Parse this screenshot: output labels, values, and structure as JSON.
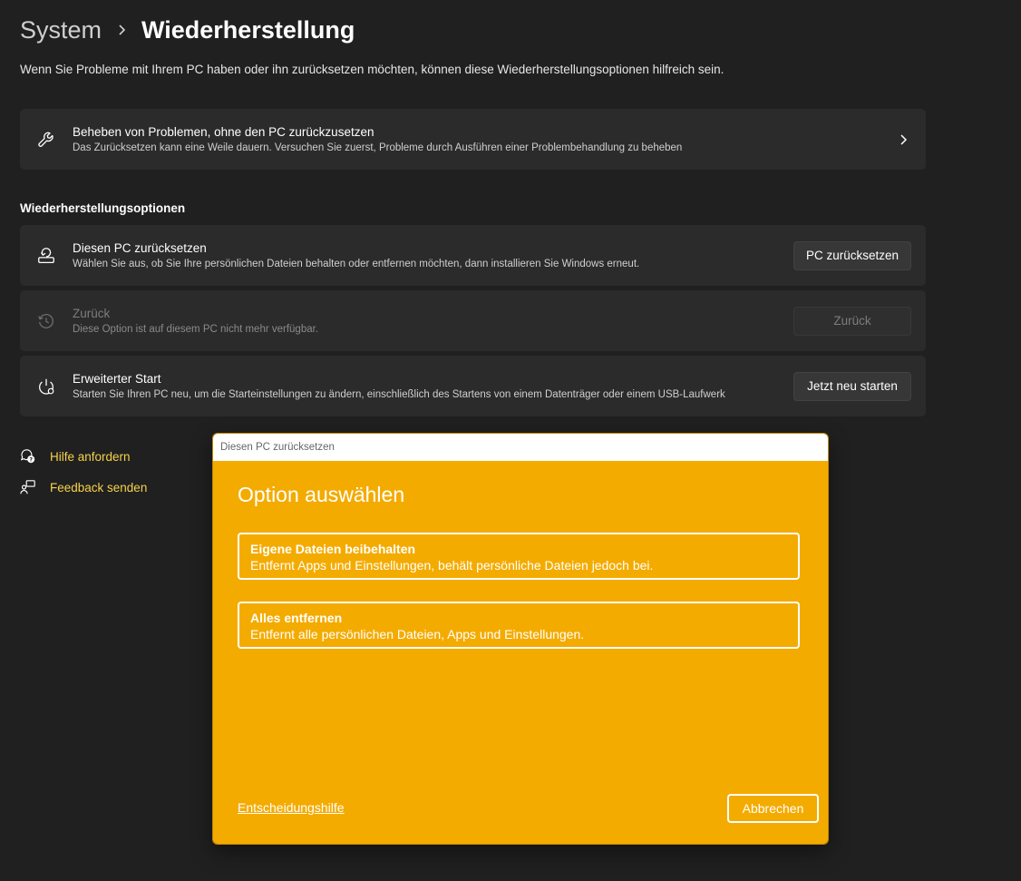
{
  "breadcrumb": {
    "parent": "System",
    "current": "Wiederherstellung"
  },
  "intro": "Wenn Sie Probleme mit Ihrem PC haben oder ihn zurücksetzen möchten, können diese Wiederherstellungsoptionen hilfreich sein.",
  "troubleshoot": {
    "title": "Beheben von Problemen, ohne den PC zurückzusetzen",
    "desc": "Das Zurücksetzen kann eine Weile dauern. Versuchen Sie zuerst, Probleme durch Ausführen einer Problembehandlung zu beheben",
    "icon": "wrench-icon"
  },
  "section_title": "Wiederherstellungsoptionen",
  "options": [
    {
      "title": "Diesen PC zurücksetzen",
      "desc": "Wählen Sie aus, ob Sie Ihre persönlichen Dateien behalten oder entfernen möchten, dann installieren Sie Windows erneut.",
      "button": "PC zurücksetzen",
      "icon": "reset-pc-icon"
    },
    {
      "title": "Zurück",
      "desc": "Diese Option ist auf diesem PC nicht mehr verfügbar.",
      "button": "Zurück",
      "icon": "history-icon"
    },
    {
      "title": "Erweiterter Start",
      "desc": "Starten Sie Ihren PC neu, um die Starteinstellungen zu ändern, einschließlich des Startens von einem Datenträger oder einem USB-Laufwerk",
      "button": "Jetzt neu starten",
      "icon": "advanced-startup-icon"
    }
  ],
  "links": {
    "help": "Hilfe anfordern",
    "feedback": "Feedback senden"
  },
  "dialog": {
    "window_title": "Diesen PC zurücksetzen",
    "heading": "Option auswählen",
    "choices": [
      {
        "title": "Eigene Dateien beibehalten",
        "desc": "Entfernt Apps und Einstellungen, behält persönliche Dateien jedoch bei."
      },
      {
        "title": "Alles entfernen",
        "desc": "Entfernt alle persönlichen Dateien, Apps und Einstellungen."
      }
    ],
    "help_link": "Entscheidungshilfe",
    "cancel": "Abbrechen"
  },
  "colors": {
    "background": "#202020",
    "card": "#2b2b2b",
    "link": "#f6d24a",
    "dialog_accent": "#f4ab00"
  }
}
